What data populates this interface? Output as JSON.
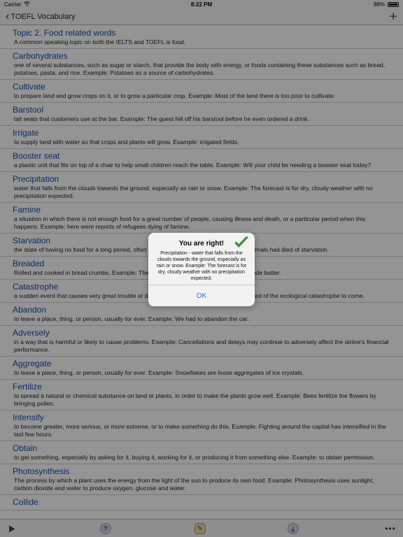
{
  "status": {
    "carrier": "Carrier",
    "time": "8:22 PM",
    "battery": "98%"
  },
  "nav": {
    "back_label": "TOEFL Vocabulary",
    "add_label": "+"
  },
  "list": [
    {
      "title": "Topic 2. Food related words",
      "desc": "A common speaking topic on both the IELTS and TOEFL is food."
    },
    {
      "title": "Carbohydrates",
      "desc": "one of several substances, such as sugar or starch, that provide the body with energy, or foods containing these substances such as bread, potatoes, pasta, and rice. Example: Potatoes as a source of carbohydrates."
    },
    {
      "title": "Cultivate",
      "desc": "to prepare land and grow crops on it, or to grow a particular crop. Example: Most of the land there is too poor to cultivate."
    },
    {
      "title": "Barstool",
      "desc": "tall seats that customers use at the bar. Example: The guest fell off his barstool before he even ordered a drink."
    },
    {
      "title": "Irrigate",
      "desc": "to supply land with water so that crops and plants will grow. Example: irrigated fields."
    },
    {
      "title": "Booster seat",
      "desc": "a plastic unit that fits on top of a chair to help small children reach the table. Example: Will your child be needing a booster seat today?"
    },
    {
      "title": "Precipitation",
      "desc": "water that falls from the clouds towards the ground, especially as rain or snow. Example: The forecast is for dry, cloudy weather with no precipitation expected."
    },
    {
      "title": "Famine",
      "desc": "a situation in which there is not enough food for a great number of people, causing illness and death, or a particular period when this happens. Example: here were reports of refugees dying of famine."
    },
    {
      "title": "Starvation",
      "desc": "the state of having no food for a long period, often causing death. Example: Most of the animals had died of starvation."
    },
    {
      "title": "Breaded",
      "desc": "Rolled and cooked in bread crumbs. Example: The breaded shrimp was dipped in homemade batter."
    },
    {
      "title": "Catastrophe",
      "desc": "a sudden event that causes very great trouble or destruction. Example: Scientists are warned of the ecological catastrophe to come."
    },
    {
      "title": "Abandon",
      "desc": "to leave a place, thing, or person, usually for ever. Example: We had to abandon the car."
    },
    {
      "title": "Adversely",
      "desc": "in a way that is harmful or likely to cause problems. Example: Cancellations and delays may continue to adversely affect the airline's financial performance."
    },
    {
      "title": "Aggregate",
      "desc": "to leave a place, thing, or person, usually for ever. Example: Snowflakes are loose aggregates of ice crystals."
    },
    {
      "title": "Fertilize",
      "desc": "to spread a natural or chemical substance on land or plants, in order to make the plants grow well. Example: Bees fertilize the flowers by bringing pollen."
    },
    {
      "title": "Intensify",
      "desc": "to become greater, more serious, or more extreme, or to make something do this. Example: Fighting around the capital has intensified in the last few hours."
    },
    {
      "title": "Obtain",
      "desc": "to get something, especially by asking for it, buying it, working for it, or producing it from something else. Example: to obtain permission."
    },
    {
      "title": "Photosynthesis",
      "desc": "The process by which a plant uses the energy from the light of the sun to produce its own food. Example: Photosynthesis uses sunlight, carbon dioxide and water to produce oxygen, glucose and water."
    },
    {
      "title": "Collide",
      "desc": ""
    }
  ],
  "toolbar": {
    "play_icon": "play-icon",
    "help_label": "?",
    "question_label": "¿",
    "more_label": "•••"
  },
  "alert": {
    "title": "You are right!",
    "message": "Precipitation  -  water that falls from the clouds towards the ground, especially as rain or snow. Example: The forecast is for dry, cloudy weather with no precipitation expected.",
    "ok_label": "OK",
    "check_color": "#3aa83a"
  }
}
